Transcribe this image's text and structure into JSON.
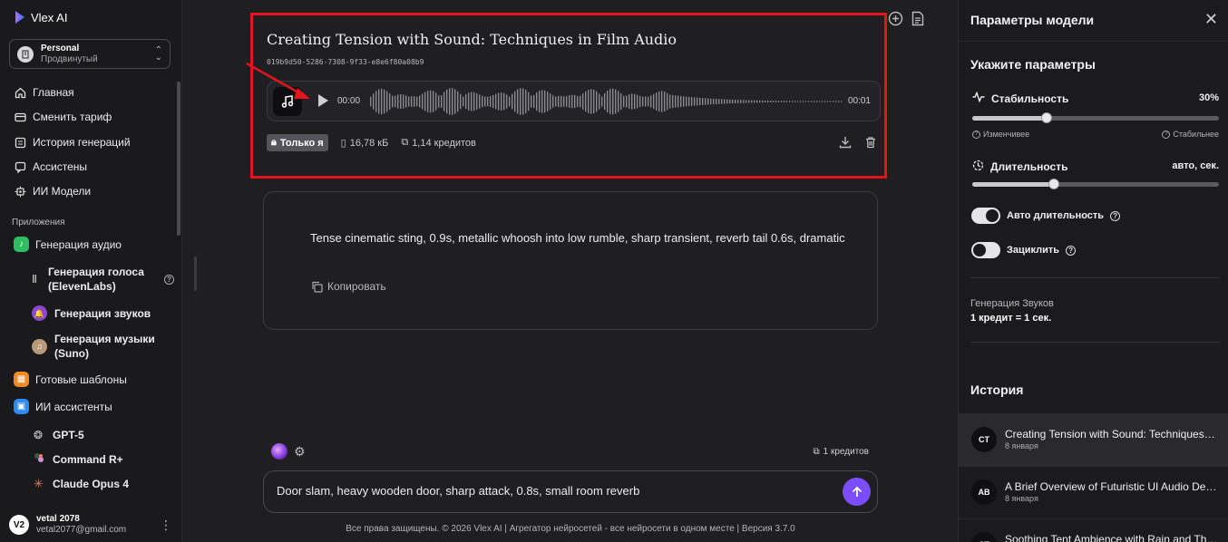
{
  "app": {
    "name": "Vlex AI"
  },
  "workspace": {
    "name": "Personal",
    "plan": "Продвинутый"
  },
  "nav": [
    {
      "label": "Главная",
      "icon": "home-icon"
    },
    {
      "label": "Сменить тариф",
      "icon": "card-icon"
    },
    {
      "label": "История генераций",
      "icon": "history-icon"
    },
    {
      "label": "Ассистены",
      "icon": "chat-icon"
    },
    {
      "label": "ИИ Модели",
      "icon": "chip-icon"
    }
  ],
  "apps_title": "Приложения",
  "apps": {
    "audio": "Генерация аудио",
    "voice": "Генерация голоса (ElevenLabs)",
    "sounds": "Генерация звуков",
    "music": "Генерация музыки (Suno)",
    "templates": "Готовые шаблоны",
    "assistants": "ИИ ассистенты",
    "gpt5": "GPT-5",
    "command": "Command R+",
    "claude": "Claude Opus 4"
  },
  "user": {
    "initials": "V2",
    "name": "vetal 2078",
    "email": "vetal2077@gmail.com"
  },
  "audio_card": {
    "title": "Creating Tension with Sound: Techniques in Film Audio",
    "id": "019b9d50-5286-7308-9f33-e8e6f80a08b9",
    "time_current": "00:00",
    "time_total": "00:01",
    "visibility": "Только я",
    "size": "16,78 кБ",
    "cost": "1,14 кредитов"
  },
  "prompt_card": {
    "text": "Tense cinematic sting, 0.9s, metallic whoosh into low rumble, sharp transient, reverb tail 0.6s, dramatic",
    "copy_label": "Копировать"
  },
  "composer": {
    "credits": "1 кредитов",
    "value": "Door slam, heavy wooden door, sharp attack, 0.8s, small room reverb"
  },
  "footer": "Все права защищены. © 2026 Vlex AI | Агрегатор нейросетей - все нейросети в одном месте | Версия 3.7.0",
  "params": {
    "title": "Параметры модели",
    "section": "Укажите параметры",
    "stability": {
      "label": "Стабильность",
      "value": "30%",
      "fraction": 0.3,
      "hint_left": "Изменчивее",
      "hint_right": "Стабильнее"
    },
    "duration": {
      "label": "Длительность",
      "value": "авто, сек.",
      "fraction": 0.33
    },
    "auto_duration": {
      "label": "Авто длительность",
      "on": true
    },
    "loop": {
      "label": "Зациклить",
      "on": false
    },
    "gen_name": "Генерация Звуков",
    "gen_rate": "1 кредит = 1 сек."
  },
  "history": {
    "title": "История",
    "items": [
      {
        "initials": "CT",
        "name": "Creating Tension with Sound: Techniques in Film Audio",
        "date": "8 января"
      },
      {
        "initials": "AB",
        "name": "A Brief Overview of Futuristic UI Audio Design",
        "date": "8 января"
      },
      {
        "initials": "ST",
        "name": "Soothing Tent Ambience with Rain and Thunder",
        "date": ""
      }
    ]
  },
  "colors": {
    "accent": "#7c4dff",
    "highlight": "#e3141b",
    "background": "#1f1f22"
  }
}
